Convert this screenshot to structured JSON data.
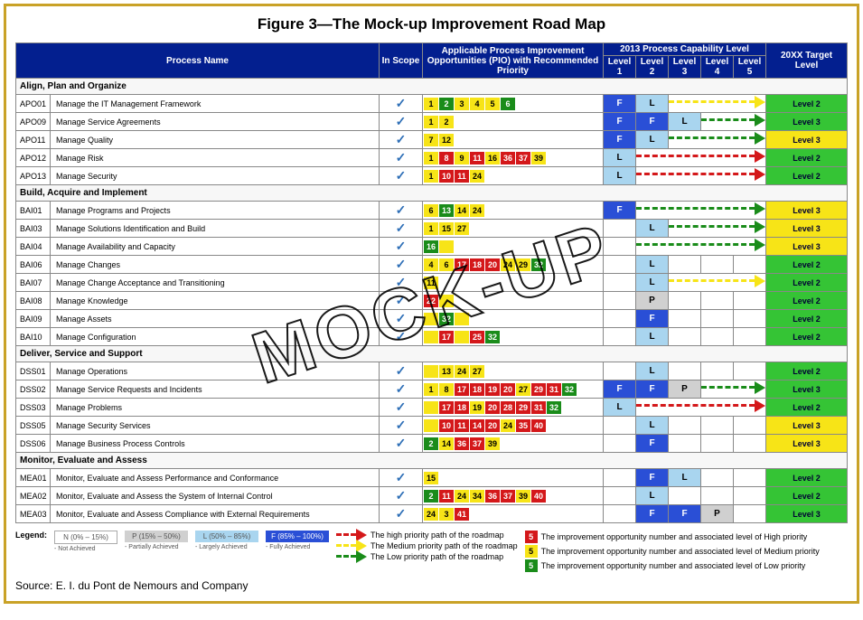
{
  "title": "Figure 3—The Mock-up Improvement Road Map",
  "watermark": "MOCK-UP",
  "source": "Source:  E. I. du Pont de Nemours and Company",
  "headers": {
    "process": "Process Name",
    "inscope": "In Scope",
    "pio": "Applicable Process Improvement Opportunities (PIO) with Recommended Priority",
    "cap2013": "2013 Process Capability Level",
    "levels": [
      "Level 1",
      "Level 2",
      "Level 3",
      "Level 4",
      "Level 5"
    ],
    "target": "20XX Target Level"
  },
  "legend": {
    "label": "Legend:",
    "N": "N (0% – 15%)",
    "Nsub": "- Not Achieved",
    "P": "P (15% – 50%)",
    "Psub": "- Partially Achieved",
    "L": "L (50% – 85%)",
    "Lsub": "- Largely Achieved",
    "F": "F (85% – 100%)",
    "Fsub": "- Fully Achieved",
    "arrHigh": "The high priority path of the roadmap",
    "arrMed": "The Medium priority path of the roadmap",
    "arrLow": "The Low priority path of the roadmap",
    "numHigh": "The improvement opportunity number and associated level of High priority",
    "numMed": "The improvement opportunity number and associated level of Medium priority",
    "numLow": "The improvement opportunity number and associated level of Low priority"
  },
  "groups": [
    {
      "name": "Align, Plan and Organize",
      "rows": [
        {
          "code": "APO01",
          "name": "Manage the IT Management Framework",
          "scope": true,
          "pio": [
            {
              "n": "1",
              "p": "y"
            },
            {
              "n": "2",
              "p": "g"
            },
            {
              "n": "3",
              "p": "y"
            },
            {
              "n": "4",
              "p": "y"
            },
            {
              "n": "5",
              "p": "y"
            },
            {
              "n": "6",
              "p": "g"
            }
          ],
          "cap": [
            "F",
            "L",
            "",
            "",
            ""
          ],
          "arrow": {
            "color": "y",
            "from": 3,
            "to": 5
          },
          "target": "Level 2",
          "tclr": "g"
        },
        {
          "code": "APO09",
          "name": "Manage Service Agreements",
          "scope": true,
          "pio": [
            {
              "n": "1",
              "p": "y"
            },
            {
              "n": "2",
              "p": "y"
            }
          ],
          "cap": [
            "F",
            "F",
            "L",
            "",
            ""
          ],
          "arrow": {
            "color": "g",
            "from": 4,
            "to": 5
          },
          "target": "Level 3",
          "tclr": "g"
        },
        {
          "code": "APO11",
          "name": "Manage Quality",
          "scope": true,
          "pio": [
            {
              "n": "7",
              "p": "y"
            },
            {
              "n": "12",
              "p": "y"
            }
          ],
          "cap": [
            "F",
            "L",
            "",
            "",
            ""
          ],
          "arrow": {
            "color": "g",
            "from": 3,
            "to": 5
          },
          "target": "Level 3",
          "tclr": "y"
        },
        {
          "code": "APO12",
          "name": "Manage Risk",
          "scope": true,
          "pio": [
            {
              "n": "1",
              "p": "y"
            },
            {
              "n": "8",
              "p": "r"
            },
            {
              "n": "9",
              "p": "y"
            },
            {
              "n": "11",
              "p": "r"
            },
            {
              "n": "16",
              "p": "y"
            },
            {
              "n": "36",
              "p": "r"
            },
            {
              "n": "37",
              "p": "r"
            },
            {
              "n": "39",
              "p": "y"
            }
          ],
          "cap": [
            "L",
            "",
            "",
            "",
            ""
          ],
          "arrow": {
            "color": "r",
            "from": 2,
            "to": 5
          },
          "target": "Level 2",
          "tclr": "g"
        },
        {
          "code": "APO13",
          "name": "Manage Security",
          "scope": true,
          "pio": [
            {
              "n": "1",
              "p": "y"
            },
            {
              "n": "10",
              "p": "r"
            },
            {
              "n": "11",
              "p": "r"
            },
            {
              "n": "24",
              "p": "y"
            }
          ],
          "cap": [
            "L",
            "",
            "",
            "",
            ""
          ],
          "arrow": {
            "color": "r",
            "from": 2,
            "to": 5
          },
          "target": "Level 2",
          "tclr": "g"
        }
      ]
    },
    {
      "name": "Build, Acquire and Implement",
      "rows": [
        {
          "code": "BAI01",
          "name": "Manage Programs and Projects",
          "scope": true,
          "pio": [
            {
              "n": "6",
              "p": "y"
            },
            {
              "n": "13",
              "p": "g"
            },
            {
              "n": "14",
              "p": "y"
            },
            {
              "n": "24",
              "p": "y"
            }
          ],
          "cap": [
            "F",
            "",
            "",
            "",
            ""
          ],
          "arrow": {
            "color": "g",
            "from": 2,
            "to": 5
          },
          "target": "Level 3",
          "tclr": "y"
        },
        {
          "code": "BAI03",
          "name": "Manage Solutions Identification and Build",
          "scope": true,
          "pio": [
            {
              "n": "1",
              "p": "y"
            },
            {
              "n": "15",
              "p": "y"
            },
            {
              "n": "27",
              "p": "y"
            }
          ],
          "cap": [
            "",
            "L",
            "",
            "",
            ""
          ],
          "arrow": {
            "color": "g",
            "from": 3,
            "to": 5
          },
          "target": "Level 3",
          "tclr": "y"
        },
        {
          "code": "BAI04",
          "name": "Manage Availability and Capacity",
          "scope": true,
          "pio": [
            {
              "n": "16",
              "p": "g"
            },
            {
              "n": "",
              "p": "y"
            }
          ],
          "cap": [
            "",
            "",
            "",
            "",
            ""
          ],
          "arrow": {
            "color": "g",
            "from": 2,
            "to": 5
          },
          "target": "Level 3",
          "tclr": "y"
        },
        {
          "code": "BAI06",
          "name": "Manage Changes",
          "scope": true,
          "pio": [
            {
              "n": "4",
              "p": "y"
            },
            {
              "n": "6",
              "p": "y"
            },
            {
              "n": "17",
              "p": "r"
            },
            {
              "n": "18",
              "p": "r"
            },
            {
              "n": "20",
              "p": "r"
            },
            {
              "n": "24",
              "p": "y"
            },
            {
              "n": "29",
              "p": "y"
            },
            {
              "n": "32",
              "p": "g"
            }
          ],
          "cap": [
            "",
            "L",
            "",
            "",
            ""
          ],
          "arrow": {
            "color": "r",
            "from": 2,
            "to": 5
          },
          "target": "Level 2",
          "tclr": "g"
        },
        {
          "code": "BAI07",
          "name": "Manage Change Acceptance and Transitioning",
          "scope": true,
          "pio": [
            {
              "n": "11",
              "p": "y"
            }
          ],
          "cap": [
            "",
            "L",
            "",
            "",
            ""
          ],
          "arrow": {
            "color": "y",
            "from": 3,
            "to": 5
          },
          "target": "Level 2",
          "tclr": "g"
        },
        {
          "code": "BAI08",
          "name": "Manage Knowledge",
          "scope": true,
          "pio": [
            {
              "n": "22",
              "p": "r"
            },
            {
              "n": "",
              "p": "y"
            }
          ],
          "cap": [
            "",
            "P",
            "",
            "",
            ""
          ],
          "arrow": {
            "color": "r",
            "from": 2,
            "to": 5
          },
          "target": "Level 2",
          "tclr": "g"
        },
        {
          "code": "BAI09",
          "name": "Manage Assets",
          "scope": true,
          "pio": [
            {
              "n": "",
              "p": "y"
            },
            {
              "n": "32",
              "p": "g"
            },
            {
              "n": "",
              "p": "y"
            }
          ],
          "cap": [
            "",
            "F",
            "",
            "",
            ""
          ],
          "arrow": {
            "color": "r",
            "from": 2,
            "to": 5
          },
          "target": "Level 2",
          "tclr": "g"
        },
        {
          "code": "BAI10",
          "name": "Manage Configuration",
          "scope": true,
          "pio": [
            {
              "n": "",
              "p": "y"
            },
            {
              "n": "17",
              "p": "r"
            },
            {
              "n": "",
              "p": "y"
            },
            {
              "n": "25",
              "p": "r"
            },
            {
              "n": "32",
              "p": "g"
            }
          ],
          "cap": [
            "",
            "L",
            "",
            "",
            ""
          ],
          "arrow": {
            "color": "r",
            "from": 2,
            "to": 5
          },
          "target": "Level 2",
          "tclr": "g"
        }
      ]
    },
    {
      "name": "Deliver, Service and Support",
      "rows": [
        {
          "code": "DSS01",
          "name": "Manage Operations",
          "scope": true,
          "pio": [
            {
              "n": "",
              "p": "y"
            },
            {
              "n": "13",
              "p": "y"
            },
            {
              "n": "24",
              "p": "y"
            },
            {
              "n": "27",
              "p": "y"
            }
          ],
          "cap": [
            "",
            "L",
            "",
            "",
            ""
          ],
          "arrow": {
            "color": "y",
            "from": 2,
            "to": 5
          },
          "target": "Level 2",
          "tclr": "g"
        },
        {
          "code": "DSS02",
          "name": "Manage Service Requests and Incidents",
          "scope": true,
          "pio": [
            {
              "n": "1",
              "p": "y"
            },
            {
              "n": "8",
              "p": "y"
            },
            {
              "n": "17",
              "p": "r"
            },
            {
              "n": "18",
              "p": "r"
            },
            {
              "n": "19",
              "p": "r"
            },
            {
              "n": "20",
              "p": "r"
            },
            {
              "n": "27",
              "p": "y"
            },
            {
              "n": "29",
              "p": "r"
            },
            {
              "n": "31",
              "p": "r"
            },
            {
              "n": "32",
              "p": "g"
            }
          ],
          "cap": [
            "F",
            "F",
            "P",
            "",
            ""
          ],
          "arrow": {
            "color": "g",
            "from": 4,
            "to": 5
          },
          "target": "Level 3",
          "tclr": "g"
        },
        {
          "code": "DSS03",
          "name": "Manage Problems",
          "scope": true,
          "pio": [
            {
              "n": "",
              "p": "y"
            },
            {
              "n": "17",
              "p": "r"
            },
            {
              "n": "18",
              "p": "r"
            },
            {
              "n": "19",
              "p": "y"
            },
            {
              "n": "20",
              "p": "r"
            },
            {
              "n": "28",
              "p": "r"
            },
            {
              "n": "29",
              "p": "r"
            },
            {
              "n": "31",
              "p": "r"
            },
            {
              "n": "32",
              "p": "g"
            }
          ],
          "cap": [
            "L",
            "",
            "",
            "",
            ""
          ],
          "arrow": {
            "color": "r",
            "from": 2,
            "to": 5
          },
          "target": "Level 2",
          "tclr": "g"
        },
        {
          "code": "DSS05",
          "name": "Manage Security Services",
          "scope": true,
          "pio": [
            {
              "n": "",
              "p": "y"
            },
            {
              "n": "10",
              "p": "r"
            },
            {
              "n": "11",
              "p": "r"
            },
            {
              "n": "14",
              "p": "r"
            },
            {
              "n": "20",
              "p": "r"
            },
            {
              "n": "24",
              "p": "y"
            },
            {
              "n": "35",
              "p": "r"
            },
            {
              "n": "40",
              "p": "r"
            }
          ],
          "cap": [
            "",
            "L",
            "",
            "",
            ""
          ],
          "arrow": {
            "color": "r",
            "from": 2,
            "to": 5
          },
          "target": "Level 3",
          "tclr": "y"
        },
        {
          "code": "DSS06",
          "name": "Manage Business Process Controls",
          "scope": true,
          "pio": [
            {
              "n": "2",
              "p": "g"
            },
            {
              "n": "14",
              "p": "y"
            },
            {
              "n": "36",
              "p": "r"
            },
            {
              "n": "37",
              "p": "r"
            },
            {
              "n": "39",
              "p": "y"
            }
          ],
          "cap": [
            "",
            "F",
            "",
            "",
            ""
          ],
          "arrow": {
            "color": "r",
            "from": 2,
            "to": 5
          },
          "target": "Level 3",
          "tclr": "y"
        }
      ]
    },
    {
      "name": "Monitor, Evaluate and Assess",
      "rows": [
        {
          "code": "MEA01",
          "name": "Monitor, Evaluate and Assess Performance and Conformance",
          "scope": true,
          "pio": [
            {
              "n": "15",
              "p": "y"
            }
          ],
          "cap": [
            "",
            "F",
            "L",
            "",
            ""
          ],
          "arrow": {
            "color": "r",
            "from": 2,
            "to": 5
          },
          "target": "Level 2",
          "tclr": "g"
        },
        {
          "code": "MEA02",
          "name": "Monitor, Evaluate and Assess the System of Internal Control",
          "scope": true,
          "pio": [
            {
              "n": "2",
              "p": "g"
            },
            {
              "n": "11",
              "p": "r"
            },
            {
              "n": "24",
              "p": "y"
            },
            {
              "n": "34",
              "p": "y"
            },
            {
              "n": "36",
              "p": "r"
            },
            {
              "n": "37",
              "p": "r"
            },
            {
              "n": "39",
              "p": "y"
            },
            {
              "n": "40",
              "p": "r"
            }
          ],
          "cap": [
            "",
            "L",
            "",
            "",
            ""
          ],
          "arrow": {
            "color": "r",
            "from": 2,
            "to": 5
          },
          "target": "Level 2",
          "tclr": "g"
        },
        {
          "code": "MEA03",
          "name": "Monitor, Evaluate and Assess Compliance with External Requirements",
          "scope": true,
          "pio": [
            {
              "n": "24",
              "p": "y"
            },
            {
              "n": "3",
              "p": "y"
            },
            {
              "n": "41",
              "p": "r"
            }
          ],
          "cap": [
            "",
            "F",
            "F",
            "P",
            ""
          ],
          "arrow": {
            "color": "g",
            "from": 4,
            "to": 5
          },
          "target": "Level 3",
          "tclr": "g"
        }
      ]
    }
  ]
}
